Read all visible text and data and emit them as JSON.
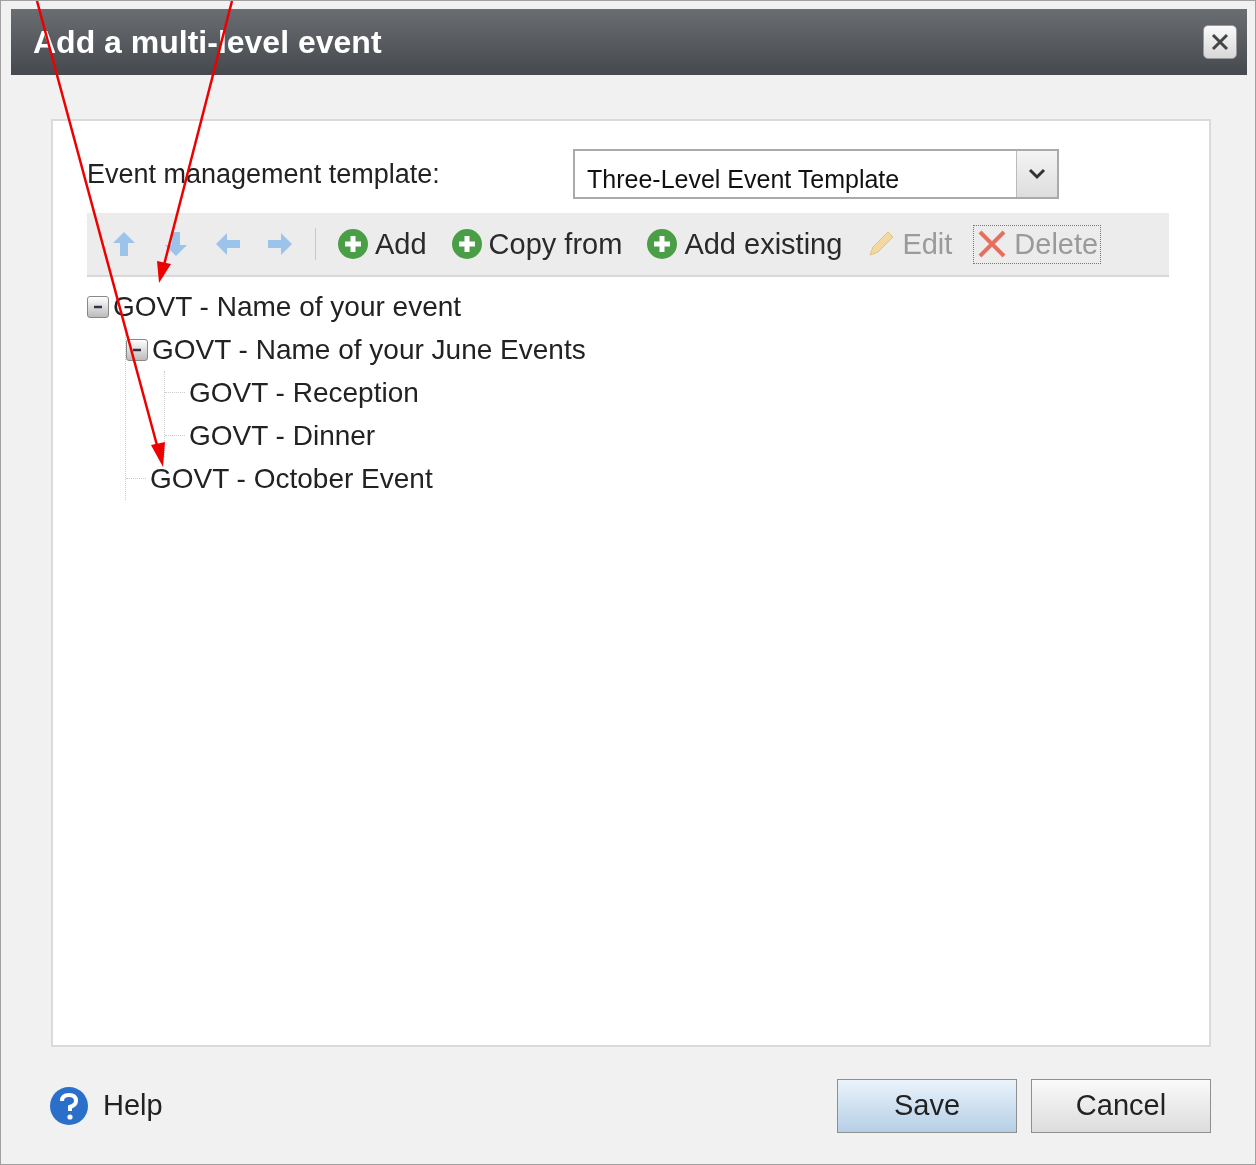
{
  "window": {
    "title": "Add a multi-level event"
  },
  "template": {
    "label": "Event management template:",
    "value": "Three-Level Event Template"
  },
  "toolbar": [
    {
      "kind": "up",
      "disabled": true
    },
    {
      "kind": "down",
      "disabled": true
    },
    {
      "kind": "left",
      "disabled": true
    },
    {
      "kind": "right",
      "disabled": true
    },
    {
      "kind": "add",
      "label": "Add",
      "disabled": false
    },
    {
      "kind": "add",
      "label": "Copy from",
      "disabled": false
    },
    {
      "kind": "add",
      "label": "Add existing",
      "disabled": false
    },
    {
      "kind": "edit",
      "label": "Edit",
      "disabled": true
    },
    {
      "kind": "delete",
      "label": "Delete",
      "disabled": true
    }
  ],
  "tree": [
    {
      "label": "GOVT - Name of your event",
      "expanded": true,
      "children": [
        {
          "label": "GOVT - Name of your June Events",
          "expanded": true,
          "children": [
            {
              "label": "GOVT - Reception"
            },
            {
              "label": "GOVT - Dinner"
            }
          ]
        },
        {
          "label": "GOVT - October Event"
        }
      ]
    }
  ],
  "footer": {
    "help": "Help",
    "buttons": [
      {
        "label": "Save",
        "kind": "primary"
      },
      {
        "label": "Cancel",
        "kind": "secondary"
      }
    ]
  }
}
